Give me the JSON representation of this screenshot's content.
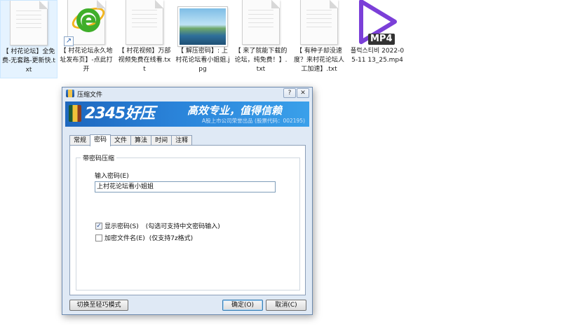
{
  "files": [
    {
      "name": "【 村花论坛】全免费-无套路-更新快.txt",
      "kind": "txt"
    },
    {
      "name": "【 村花论坛永久地址发布页】-点此打开",
      "kind": "shortcut"
    },
    {
      "name": "【 村花视频】万部视频免费在线看.txt",
      "kind": "txt"
    },
    {
      "name": "【 解压密码】: 上村花论坛看小姐姐.jpg",
      "kind": "jpg"
    },
    {
      "name": "【 来了就能下载的论坛，纯免费！】.txt",
      "kind": "txt"
    },
    {
      "name": "【 有种子却没速度？来村花论坛人工加速】.txt",
      "kind": "txt"
    },
    {
      "name": "플럭스티비 2022-05-11 13_25.mp4",
      "kind": "mp4",
      "badge": "MP4"
    }
  ],
  "dialog": {
    "title": "压缩文件",
    "banner": {
      "brand": "2345好压",
      "slogan": "高效专业，值得信赖",
      "sub": "A股上市公司荣誉出品 (股票代码：002195)"
    },
    "tabs": [
      "常规",
      "密码",
      "文件",
      "算法",
      "时间",
      "注释"
    ],
    "group_title": "带密码压缩",
    "password_label": "输入密码(E)",
    "password_value": "上村花论坛看小姐姐",
    "show_password": "显示密码(S)",
    "show_password_hint": "(勾选可支持中文密码输入)",
    "encrypt_names": "加密文件名(E)",
    "encrypt_names_hint": "(仅支持7z格式)",
    "buttons": {
      "switch_mode": "切换至轻巧模式",
      "ok": "确定(O)",
      "cancel": "取消(C)"
    },
    "window_controls": [
      "?",
      "✕"
    ]
  }
}
